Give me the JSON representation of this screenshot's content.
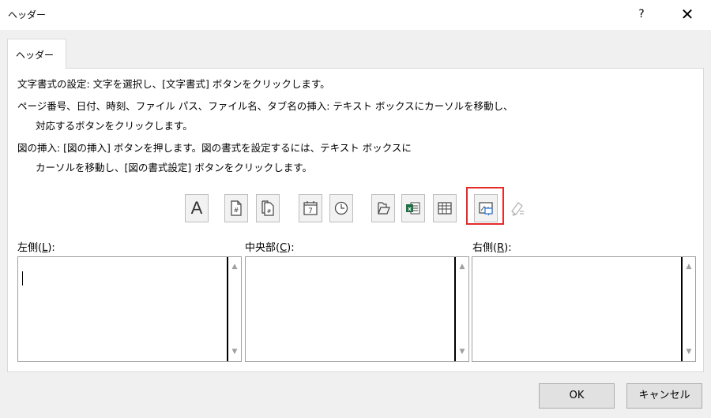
{
  "dialog": {
    "title": "ヘッダー",
    "help_label": "?",
    "close_label": "✕"
  },
  "tab": {
    "label": "ヘッダー"
  },
  "instructions": [
    "文字書式の設定: 文字を選択し、[文字書式] ボタンをクリックします。",
    "ページ番号、日付、時刻、ファイル パス、ファイル名、タブ名の挿入: テキスト ボックスにカーソルを移動し、",
    "対応するボタンをクリックします。",
    "図の挿入: [図の挿入] ボタンを押します。図の書式を設定するには、テキスト ボックスに",
    "カーソルを移動し、[図の書式設定] ボタンをクリックします。"
  ],
  "toolbar": {
    "buttons": [
      {
        "name": "format-text-button",
        "icon": "font-A-icon",
        "glyph": "A",
        "enabled": true
      },
      {
        "name": "insert-page-number-button",
        "icon": "page-number-icon",
        "enabled": true
      },
      {
        "name": "insert-number-of-pages-button",
        "icon": "number-of-pages-icon",
        "enabled": true
      },
      {
        "name": "insert-date-button",
        "icon": "calendar-icon",
        "glyph": "7",
        "enabled": true
      },
      {
        "name": "insert-time-button",
        "icon": "clock-icon",
        "enabled": true
      },
      {
        "name": "insert-file-path-button",
        "icon": "folder-icon",
        "enabled": true
      },
      {
        "name": "insert-file-name-button",
        "icon": "excel-file-icon",
        "glyph": "x",
        "enabled": true
      },
      {
        "name": "insert-sheet-name-button",
        "icon": "sheet-grid-icon",
        "enabled": true
      },
      {
        "name": "insert-picture-button",
        "icon": "picture-icon",
        "enabled": true,
        "highlighted": true
      },
      {
        "name": "format-picture-button",
        "icon": "format-picture-icon",
        "enabled": false
      }
    ],
    "highlight_color": "#e52a2a"
  },
  "sections": {
    "left": {
      "label": "左側(",
      "mnemonic": "L",
      "label_end": "):",
      "value": ""
    },
    "center": {
      "label": "中央部(",
      "mnemonic": "C",
      "label_end": "):",
      "value": ""
    },
    "right": {
      "label": "右側(",
      "mnemonic": "R",
      "label_end": "):",
      "value": ""
    }
  },
  "scroll": {
    "up_icon": "▲",
    "down_icon": "▼"
  },
  "buttons": {
    "ok_label": "OK",
    "cancel_label": "キャンセル"
  }
}
